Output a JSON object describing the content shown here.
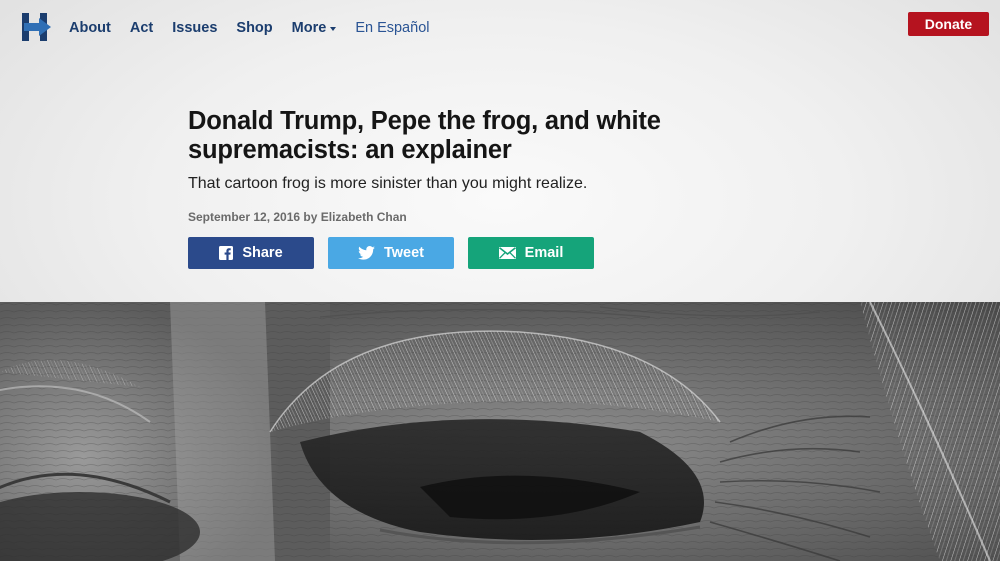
{
  "nav": {
    "links": [
      "About",
      "Act",
      "Issues",
      "Shop",
      "More"
    ],
    "language_link": "En Español",
    "donate_label": "Donate",
    "logo_icon": "h-arrow-logo-icon",
    "colors": {
      "brand_blue": "#1b3d6e",
      "logo_arrow": "#2f6fb5",
      "donate_red": "#b5131f"
    }
  },
  "article": {
    "title": "Donald Trump, Pepe the frog, and white supremacists: an explainer",
    "subtitle": "That cartoon frog is more sinister than you might realize.",
    "byline": "September 12, 2016 by Elizabeth Chan"
  },
  "share": {
    "facebook": {
      "label": "Share",
      "icon": "facebook-icon",
      "color": "#2b4a8b"
    },
    "twitter": {
      "label": "Tweet",
      "icon": "twitter-bird-icon",
      "color": "#4aa8e4"
    },
    "email": {
      "label": "Email",
      "icon": "envelope-icon",
      "color": "#15a47a"
    }
  },
  "hero": {
    "description_icon": "close-up-face-photo",
    "tone": "black-and-white"
  }
}
